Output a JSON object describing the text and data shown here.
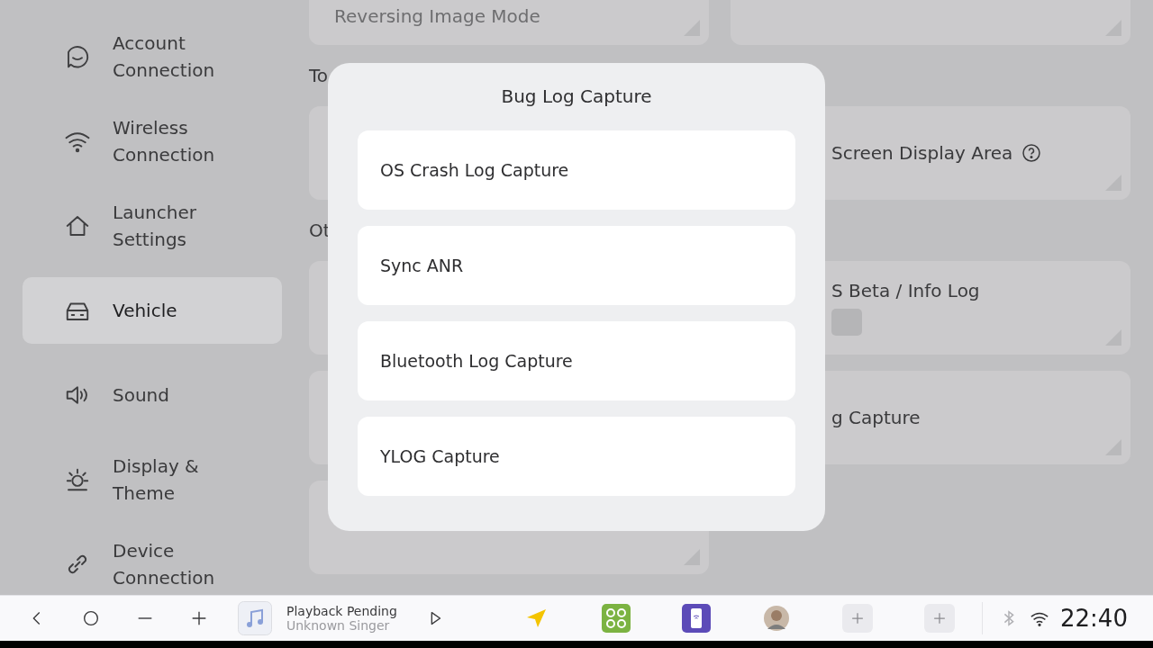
{
  "sidebar": {
    "items": [
      {
        "label": "Account Connection",
        "selected": false
      },
      {
        "label": "Wireless Connection",
        "selected": false
      },
      {
        "label": "Launcher Settings",
        "selected": false
      },
      {
        "label": "Vehicle",
        "selected": true
      },
      {
        "label": "Sound",
        "selected": false
      },
      {
        "label": "Display & Theme",
        "selected": false
      },
      {
        "label": "Device Connection",
        "selected": false
      }
    ]
  },
  "content": {
    "left_column": [
      {
        "kind": "top-card",
        "label": "Reversing Image Mode"
      },
      {
        "kind": "heading",
        "label": "To"
      },
      {
        "kind": "card"
      },
      {
        "kind": "heading",
        "label": "Ot"
      },
      {
        "kind": "card"
      },
      {
        "kind": "gap"
      },
      {
        "kind": "card"
      },
      {
        "kind": "gap"
      },
      {
        "kind": "card"
      }
    ],
    "right_column": [
      {
        "kind": "top-card"
      },
      {
        "kind": "heading"
      },
      {
        "kind": "card",
        "label": "Screen Display Area",
        "help": true
      },
      {
        "kind": "heading"
      },
      {
        "kind": "card",
        "label": "S Beta / Info Log",
        "badge": true
      },
      {
        "kind": "gap"
      },
      {
        "kind": "card",
        "label": "g Capture"
      }
    ]
  },
  "dialog": {
    "title": "Bug Log Capture",
    "options": [
      "OS Crash Log Capture",
      "Sync ANR",
      "Bluetooth Log Capture",
      "YLOG Capture"
    ]
  },
  "taskbar": {
    "media": {
      "title": "Playback Pending",
      "artist": "Unknown Singer"
    },
    "time": "22:40"
  }
}
